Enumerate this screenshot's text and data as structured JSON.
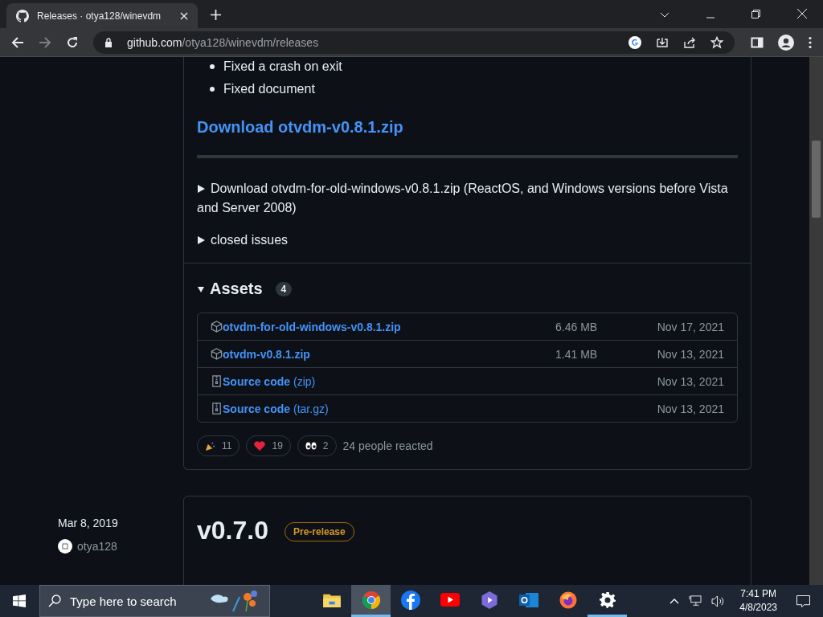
{
  "browser": {
    "tab_title": "Releases · otya128/winevdm",
    "url_host": "github.com",
    "url_path": "/otya128/winevdm/releases"
  },
  "release": {
    "notes": [
      "Fixed a crash on exit",
      "Fixed document"
    ],
    "download_link": "Download otvdm-v0.8.1.zip",
    "details": [
      {
        "text": "Download otvdm-for-old-windows-v0.8.1.zip (ReactOS, and Windows versions before Vista and Server 2008)",
        "expanded": false
      },
      {
        "text": "closed issues",
        "expanded": false
      }
    ],
    "assets": {
      "title": "Assets",
      "count": "4",
      "expanded": true,
      "rows": [
        {
          "kind": "package",
          "name": "otvdm-for-old-windows-v0.8.1.zip",
          "size": "6.46 MB",
          "date": "Nov 17, 2021"
        },
        {
          "kind": "package",
          "name": "otvdm-v0.8.1.zip",
          "size": "1.41 MB",
          "date": "Nov 13, 2021"
        },
        {
          "kind": "source",
          "name": "Source code",
          "suffix": "(zip)",
          "date": "Nov 13, 2021"
        },
        {
          "kind": "source",
          "name": "Source code",
          "suffix": "(tar.gz)",
          "date": "Nov 13, 2021"
        }
      ]
    },
    "reactions": [
      {
        "kind": "tada",
        "count": "11"
      },
      {
        "kind": "heart",
        "count": "19"
      },
      {
        "kind": "eyes",
        "count": "2"
      }
    ],
    "reacted_text": "24 people reacted"
  },
  "next_release": {
    "date": "Mar 8, 2019",
    "author": "otya128",
    "title": "v0.7.0",
    "badge": "Pre-release"
  },
  "taskbar": {
    "search_placeholder": "Type here to search",
    "time": "7:41 PM",
    "date": "4/8/2023",
    "apps": [
      {
        "kind": "folder",
        "running": false,
        "active": false
      },
      {
        "kind": "chrome",
        "running": true,
        "active": true
      },
      {
        "kind": "facebook",
        "running": false,
        "active": false
      },
      {
        "kind": "youtube",
        "running": false,
        "active": false
      },
      {
        "kind": "clipchamp",
        "running": false,
        "active": false
      },
      {
        "kind": "outlook",
        "running": false,
        "active": false
      },
      {
        "kind": "firefox",
        "running": false,
        "active": false
      },
      {
        "kind": "settings",
        "running": true,
        "active": false
      }
    ]
  }
}
